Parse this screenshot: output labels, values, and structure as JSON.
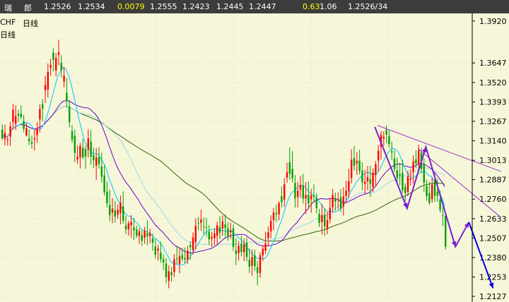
{
  "header": {
    "items": [
      {
        "key": "market_a",
        "text": "瑞",
        "color": "#ffffff"
      },
      {
        "key": "market_b",
        "text": "郎",
        "color": "#ffffff"
      },
      {
        "key": "open",
        "text": "1.2526",
        "color": "#ffffff"
      },
      {
        "key": "high",
        "text": "1.2534",
        "color": "#ffffff"
      },
      {
        "key": "change",
        "text": "0.0079",
        "color": "#ffff00"
      },
      {
        "key": "v1",
        "text": "1.2555",
        "color": "#ffffff"
      },
      {
        "key": "v2",
        "text": "1.2423",
        "color": "#ffffff"
      },
      {
        "key": "v3",
        "text": "1.2445",
        "color": "#ffffff"
      },
      {
        "key": "v4",
        "text": "1.2447",
        "color": "#ffffff"
      },
      {
        "key": "v5",
        "text": "0.63",
        "color": "#ffff00"
      },
      {
        "key": "v6",
        "text": "1.06",
        "color": "#ffffff"
      },
      {
        "key": "v7",
        "text": "1.2526/34",
        "color": "#ffffff"
      }
    ]
  },
  "chart_title": {
    "symbol": "CHF",
    "period": "日线",
    "indicator": "日线"
  },
  "colors": {
    "background": "#f6f6d9",
    "up_candle": "#ff0000",
    "down_candle": "#00a000",
    "ma_fast": "#00c8ff",
    "ma_mid": "#a0d8e8",
    "ma_slow": "#6600cc",
    "ma_long": "#336600",
    "trendline": "#9933cc",
    "zigzag": "#7a22cc",
    "forecast": "#0000ee",
    "grid": "#d8d8c0"
  },
  "chart_data": {
    "type": "candlestick",
    "yticks": [
      1.392,
      1.3647,
      1.352,
      1.3393,
      1.3267,
      1.314,
      1.3013,
      1.2887,
      1.276,
      1.2633,
      1.2507,
      1.238,
      1.2253,
      1.2127
    ],
    "ytick_labels": [
      "1.3920",
      "1.3647",
      "1.3520",
      "1.3393",
      "1.3267",
      "1.3140",
      "1.3013",
      "1.2887",
      "1.2760",
      "1.2633",
      "1.2507",
      "1.2380",
      "1.2253",
      "1.2127"
    ],
    "ylim": [
      1.209,
      1.3965
    ],
    "n_bars": 166,
    "candles": [
      [
        1.3213,
        1.3248,
        1.3145,
        1.3156
      ],
      [
        1.3151,
        1.3244,
        1.3108,
        1.3192
      ],
      [
        1.3147,
        1.3169,
        1.3109,
        1.3151
      ],
      [
        1.3167,
        1.3263,
        1.3107,
        1.3233
      ],
      [
        1.3264,
        1.3381,
        1.3214,
        1.3342
      ],
      [
        1.325,
        1.3371,
        1.3211,
        1.33
      ],
      [
        1.3314,
        1.3343,
        1.3262,
        1.3303
      ],
      [
        1.3317,
        1.3371,
        1.328,
        1.3297
      ],
      [
        1.3269,
        1.3309,
        1.3196,
        1.3217
      ],
      [
        1.3175,
        1.3257,
        1.3168,
        1.3223
      ],
      [
        1.3154,
        1.3216,
        1.3112,
        1.3138
      ],
      [
        1.3131,
        1.3174,
        1.3089,
        1.3121
      ],
      [
        1.3149,
        1.3216,
        1.3076,
        1.3156
      ],
      [
        1.3177,
        1.3261,
        1.3127,
        1.3216
      ],
      [
        1.3279,
        1.3378,
        1.3195,
        1.3347
      ],
      [
        1.3379,
        1.3413,
        1.3267,
        1.3348
      ],
      [
        1.347,
        1.3562,
        1.3387,
        1.3504
      ],
      [
        1.3474,
        1.3643,
        1.3422,
        1.3588
      ],
      [
        1.3616,
        1.3673,
        1.3563,
        1.3634
      ],
      [
        1.3715,
        1.3747,
        1.3593,
        1.3667
      ],
      [
        1.3598,
        1.371,
        1.356,
        1.3679
      ],
      [
        1.3699,
        1.3799,
        1.3631,
        1.3717
      ],
      [
        1.3649,
        1.3697,
        1.3552,
        1.36
      ],
      [
        1.3524,
        1.3621,
        1.3487,
        1.3564
      ],
      [
        1.3453,
        1.355,
        1.3355,
        1.3404
      ],
      [
        1.3364,
        1.3405,
        1.3227,
        1.3261
      ],
      [
        1.3202,
        1.3244,
        1.3127,
        1.3148
      ],
      [
        1.3173,
        1.3212,
        1.3001,
        1.3061
      ],
      [
        1.3019,
        1.3109,
        1.299,
        1.3036
      ],
      [
        1.3032,
        1.3127,
        1.296,
        1.3106
      ],
      [
        1.3095,
        1.3154,
        1.3021,
        1.3031
      ],
      [
        1.3086,
        1.3109,
        1.2956,
        1.3037
      ],
      [
        1.3083,
        1.3215,
        1.3032,
        1.3156
      ],
      [
        1.3134,
        1.321,
        1.2985,
        1.3037
      ],
      [
        1.3047,
        1.3097,
        1.2961,
        1.3013
      ],
      [
        1.2978,
        1.3093,
        1.2886,
        1.3031
      ],
      [
        1.3034,
        1.3098,
        1.296,
        1.2989
      ],
      [
        1.2972,
        1.3061,
        1.2869,
        1.2906
      ],
      [
        1.2914,
        1.2981,
        1.2784,
        1.2805
      ],
      [
        1.2808,
        1.2876,
        1.2705,
        1.2732
      ],
      [
        1.2722,
        1.2821,
        1.2617,
        1.2655
      ],
      [
        1.2672,
        1.2766,
        1.2603,
        1.2699
      ],
      [
        1.2687,
        1.2748,
        1.2607,
        1.2646
      ],
      [
        1.2659,
        1.2726,
        1.2631,
        1.269
      ],
      [
        1.267,
        1.2784,
        1.2596,
        1.2737
      ],
      [
        1.2712,
        1.2811,
        1.26,
        1.262
      ],
      [
        1.2588,
        1.2651,
        1.2532,
        1.2564
      ],
      [
        1.2562,
        1.2619,
        1.2522,
        1.2602
      ],
      [
        1.2589,
        1.2656,
        1.2508,
        1.2613
      ],
      [
        1.2576,
        1.2638,
        1.2494,
        1.2556
      ],
      [
        1.2562,
        1.2589,
        1.2508,
        1.2521
      ],
      [
        1.252,
        1.2572,
        1.2469,
        1.2551
      ],
      [
        1.2524,
        1.2557,
        1.2456,
        1.2488
      ],
      [
        1.251,
        1.2579,
        1.2469,
        1.2554
      ],
      [
        1.2539,
        1.2622,
        1.2459,
        1.2518
      ],
      [
        1.2519,
        1.2568,
        1.2472,
        1.2538
      ],
      [
        1.2502,
        1.2536,
        1.2423,
        1.2476
      ],
      [
        1.2452,
        1.25,
        1.2374,
        1.2397
      ],
      [
        1.2425,
        1.2464,
        1.2361,
        1.2438
      ],
      [
        1.2411,
        1.2484,
        1.2346,
        1.2369
      ],
      [
        1.2369,
        1.2401,
        1.2298,
        1.2348
      ],
      [
        1.234,
        1.2375,
        1.2212,
        1.2252
      ],
      [
        1.2228,
        1.2328,
        1.2179,
        1.229
      ],
      [
        1.2284,
        1.2319,
        1.2222,
        1.2264
      ],
      [
        1.2285,
        1.2403,
        1.2252,
        1.2368
      ],
      [
        1.2374,
        1.2456,
        1.2337,
        1.2371
      ],
      [
        1.2339,
        1.2445,
        1.2277,
        1.2388
      ],
      [
        1.2396,
        1.2443,
        1.2356,
        1.2372
      ],
      [
        1.2376,
        1.2446,
        1.2339,
        1.2366
      ],
      [
        1.2366,
        1.2457,
        1.2339,
        1.2424
      ],
      [
        1.2461,
        1.2485,
        1.2365,
        1.2447
      ],
      [
        1.2428,
        1.2543,
        1.24,
        1.251
      ],
      [
        1.2481,
        1.2635,
        1.2432,
        1.2586
      ],
      [
        1.2604,
        1.2644,
        1.2557,
        1.26
      ],
      [
        1.2606,
        1.2692,
        1.2555,
        1.2627
      ],
      [
        1.2584,
        1.264,
        1.253,
        1.2583
      ],
      [
        1.2578,
        1.2637,
        1.2516,
        1.2574
      ],
      [
        1.2547,
        1.2592,
        1.2463,
        1.2498
      ],
      [
        1.2502,
        1.2547,
        1.2448,
        1.2514
      ],
      [
        1.2506,
        1.2569,
        1.246,
        1.2537
      ],
      [
        1.2521,
        1.2613,
        1.2466,
        1.2589
      ],
      [
        1.2578,
        1.2651,
        1.25,
        1.2542
      ],
      [
        1.2568,
        1.2653,
        1.2521,
        1.2615
      ],
      [
        1.2596,
        1.2661,
        1.2512,
        1.2571
      ],
      [
        1.2571,
        1.261,
        1.2489,
        1.2519
      ],
      [
        1.2544,
        1.2607,
        1.2501,
        1.2557
      ],
      [
        1.257,
        1.2595,
        1.2423,
        1.2449
      ],
      [
        1.2426,
        1.2504,
        1.233,
        1.2403
      ],
      [
        1.2409,
        1.2487,
        1.2359,
        1.2455
      ],
      [
        1.2468,
        1.252,
        1.2387,
        1.2415
      ],
      [
        1.2415,
        1.2503,
        1.2357,
        1.2465
      ],
      [
        1.2476,
        1.251,
        1.2354,
        1.2384
      ],
      [
        1.2365,
        1.2439,
        1.2279,
        1.2319
      ],
      [
        1.2326,
        1.2433,
        1.2262,
        1.2382
      ],
      [
        1.2393,
        1.243,
        1.2293,
        1.2323
      ],
      [
        1.2317,
        1.2357,
        1.2199,
        1.2278
      ],
      [
        1.2279,
        1.2414,
        1.2249,
        1.2394
      ],
      [
        1.2393,
        1.246,
        1.2356,
        1.2437
      ],
      [
        1.2424,
        1.2548,
        1.2403,
        1.2471
      ],
      [
        1.2506,
        1.2581,
        1.2452,
        1.2544
      ],
      [
        1.255,
        1.2655,
        1.2505,
        1.2618
      ],
      [
        1.2623,
        1.2702,
        1.2557,
        1.2673
      ],
      [
        1.2669,
        1.2722,
        1.2611,
        1.2661
      ],
      [
        1.2661,
        1.2748,
        1.2621,
        1.2734
      ],
      [
        1.2779,
        1.2842,
        1.2705,
        1.274
      ],
      [
        1.2757,
        1.2897,
        1.2709,
        1.2857
      ],
      [
        1.29,
        1.2998,
        1.2866,
        1.2935
      ],
      [
        1.3,
        1.3097,
        1.2887,
        1.2925
      ],
      [
        1.2958,
        1.3073,
        1.2869,
        1.2895
      ],
      [
        1.2866,
        1.2918,
        1.2705,
        1.2764
      ],
      [
        1.2773,
        1.2874,
        1.2706,
        1.2816
      ],
      [
        1.2822,
        1.2913,
        1.2768,
        1.2852
      ],
      [
        1.2846,
        1.2925,
        1.2731,
        1.2764
      ],
      [
        1.2765,
        1.2871,
        1.2664,
        1.2787
      ],
      [
        1.2788,
        1.2876,
        1.2697,
        1.2732
      ],
      [
        1.2759,
        1.2827,
        1.2672,
        1.2784
      ],
      [
        1.2783,
        1.2856,
        1.2737,
        1.2776
      ],
      [
        1.2768,
        1.2799,
        1.2667,
        1.2702
      ],
      [
        1.2664,
        1.2696,
        1.2578,
        1.2605
      ],
      [
        1.2611,
        1.2728,
        1.2529,
        1.2656
      ],
      [
        1.2659,
        1.27,
        1.2519,
        1.2583
      ],
      [
        1.2566,
        1.2677,
        1.2531,
        1.2623
      ],
      [
        1.2629,
        1.2767,
        1.2603,
        1.2703
      ],
      [
        1.2707,
        1.2827,
        1.2673,
        1.2788
      ],
      [
        1.2764,
        1.2802,
        1.2684,
        1.2744
      ],
      [
        1.276,
        1.2804,
        1.2693,
        1.276
      ],
      [
        1.2773,
        1.2824,
        1.2676,
        1.2698
      ],
      [
        1.2713,
        1.2837,
        1.2653,
        1.2777
      ],
      [
        1.2781,
        1.2879,
        1.2733,
        1.2815
      ],
      [
        1.281,
        1.2957,
        1.277,
        1.2878
      ],
      [
        1.2898,
        1.3085,
        1.2863,
        1.3017
      ],
      [
        1.3027,
        1.3108,
        1.2946,
        1.2978
      ],
      [
        1.2992,
        1.3067,
        1.2918,
        1.3009
      ],
      [
        1.3011,
        1.3082,
        1.292,
        1.2942
      ],
      [
        1.2946,
        1.3,
        1.2818,
        1.287
      ],
      [
        1.2859,
        1.2951,
        1.2792,
        1.2873
      ],
      [
        1.2875,
        1.2977,
        1.2817,
        1.2904
      ],
      [
        1.289,
        1.2977,
        1.2776,
        1.286
      ],
      [
        1.2839,
        1.2959,
        1.2806,
        1.2933
      ],
      [
        1.2917,
        1.3008,
        1.2849,
        1.2988
      ],
      [
        1.3011,
        1.3114,
        1.2943,
        1.3076
      ],
      [
        1.31,
        1.3204,
        1.3019,
        1.3179
      ],
      [
        1.3155,
        1.3202,
        1.3108,
        1.3166
      ],
      [
        1.321,
        1.3241,
        1.3126,
        1.318
      ],
      [
        1.3172,
        1.3209,
        1.3097,
        1.3118
      ],
      [
        1.3072,
        1.3135,
        1.3015,
        1.3063
      ],
      [
        1.3025,
        1.3079,
        1.2936,
        1.2957
      ],
      [
        1.2946,
        1.3031,
        1.2861,
        1.2899
      ],
      [
        1.2922,
        1.2996,
        1.2851,
        1.2912
      ],
      [
        1.2931,
        1.3016,
        1.2801,
        1.2818
      ],
      [
        1.2841,
        1.2864,
        1.2745,
        1.2799
      ],
      [
        1.2807,
        1.2945,
        1.2779,
        1.2909
      ],
      [
        1.2886,
        1.2956,
        1.2849,
        1.2895
      ],
      [
        1.2938,
        1.3047,
        1.2862,
        1.3006
      ],
      [
        1.3019,
        1.3078,
        1.2961,
        1.2993
      ],
      [
        1.299,
        1.3115,
        1.2952,
        1.3079
      ],
      [
        1.3061,
        1.3094,
        1.293,
        1.2958
      ],
      [
        1.2985,
        1.3026,
        1.2806,
        1.2867
      ],
      [
        1.2845,
        1.2885,
        1.2749,
        1.2779
      ],
      [
        1.2799,
        1.2875,
        1.2722,
        1.2736
      ],
      [
        1.276,
        1.29,
        1.2737,
        1.2855
      ],
      [
        1.2883,
        1.2926,
        1.274,
        1.2782
      ],
      [
        1.2809,
        1.2889,
        1.2742,
        1.2781
      ],
      [
        1.2758,
        1.2814,
        1.2672,
        1.2691
      ],
      [
        1.2654,
        1.271,
        1.2585,
        1.2652
      ],
      [
        1.2651,
        1.267,
        1.2432,
        1.245
      ]
    ],
    "zigzag": [
      [
        139,
        1.323
      ],
      [
        151,
        1.27
      ],
      [
        158,
        1.31
      ],
      [
        169,
        1.245
      ],
      [
        174,
        1.261
      ]
    ],
    "forecast": [
      [
        174,
        1.261
      ],
      [
        183,
        1.218
      ]
    ],
    "trendlines": [
      {
        "from": [
          140,
          1.324
        ],
        "to": [
          186,
          1.294
        ]
      },
      {
        "from": [
          155,
          1.309
        ],
        "to": [
          186,
          1.264
        ]
      }
    ]
  }
}
